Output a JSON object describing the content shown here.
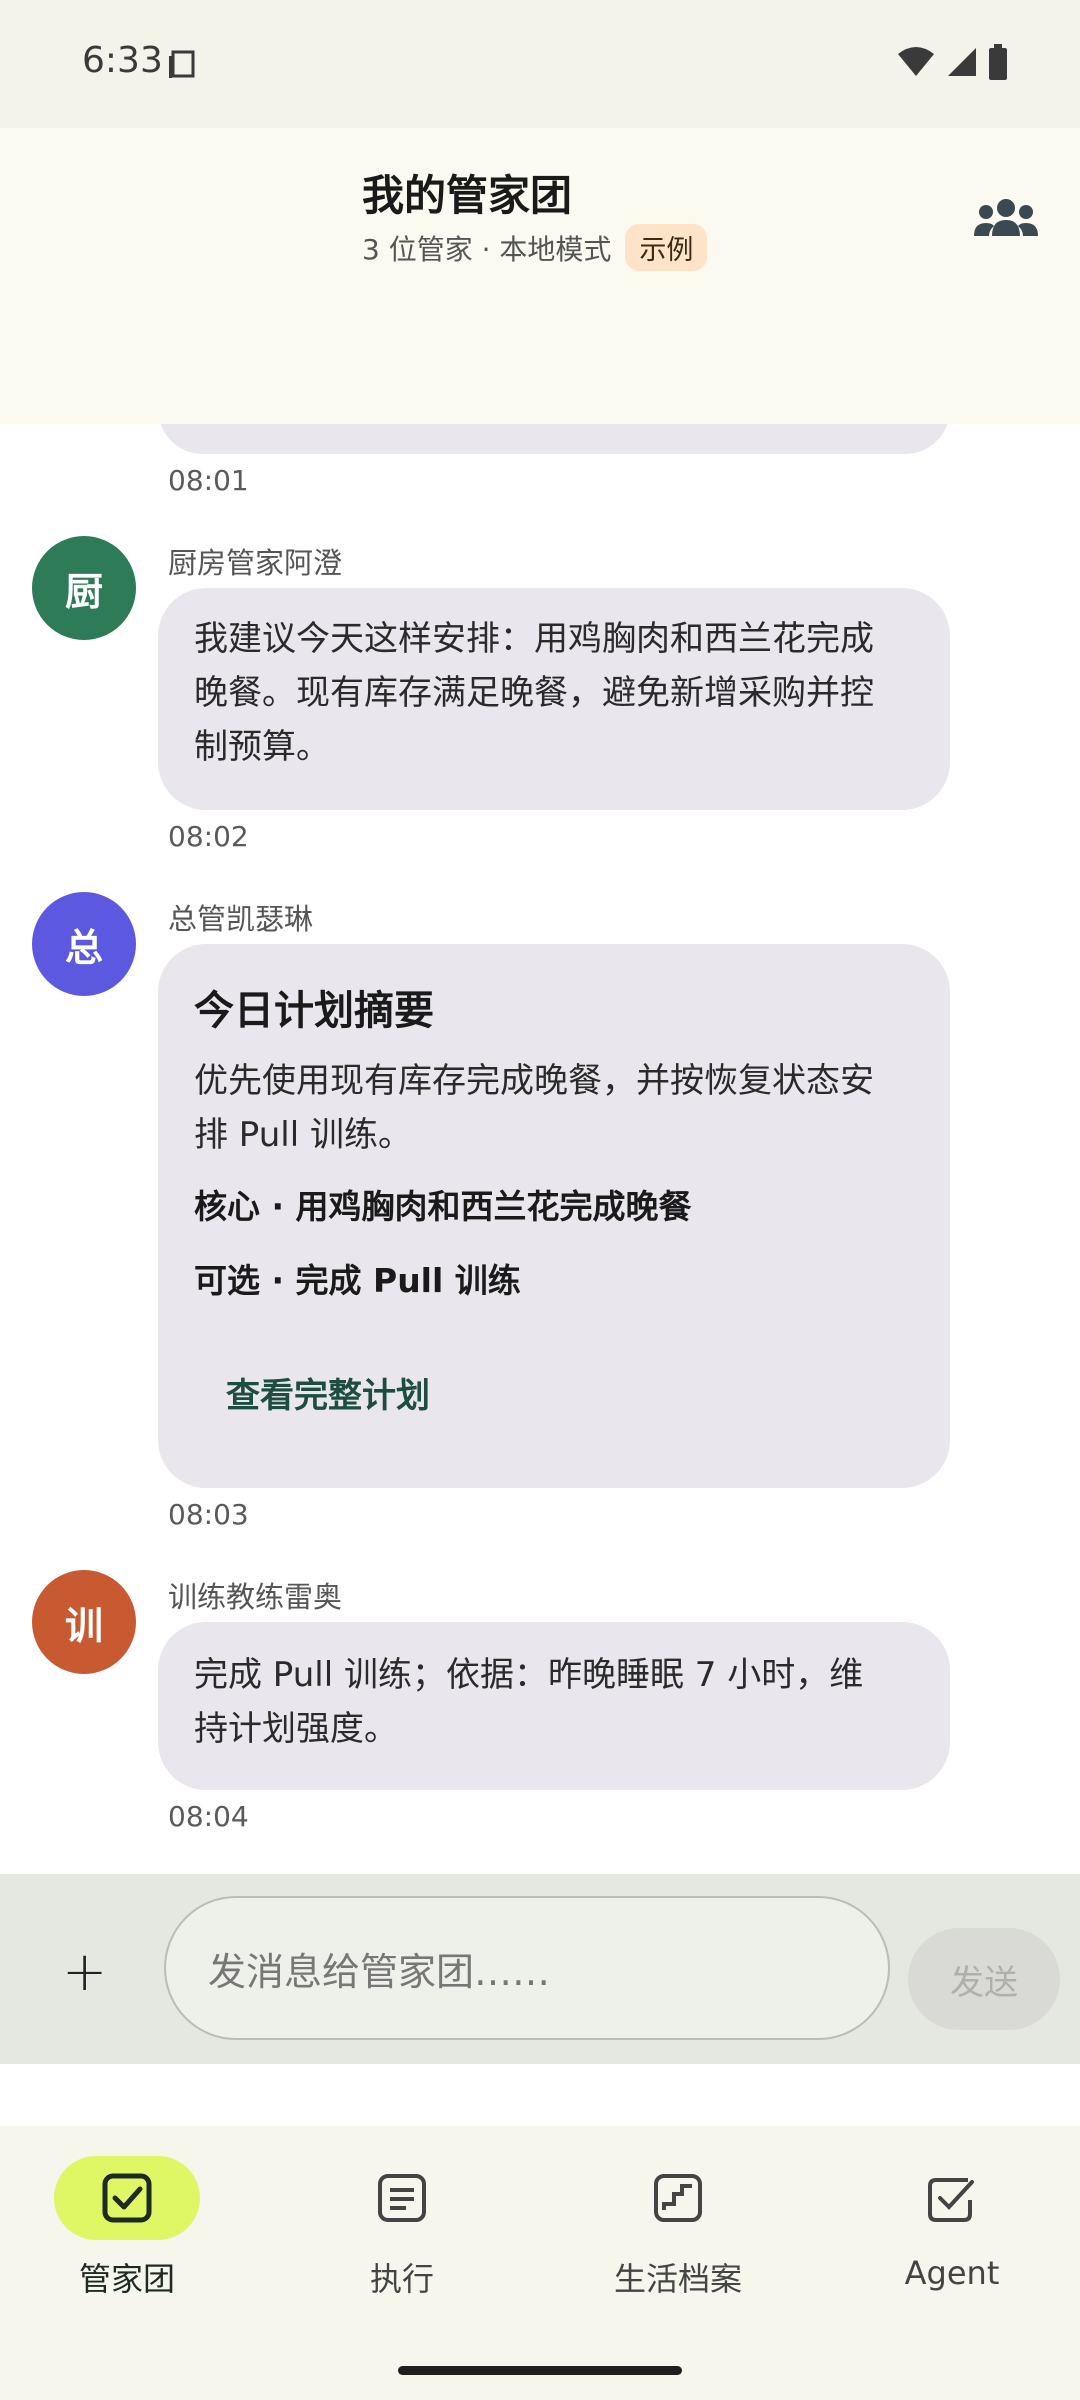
{
  "status": {
    "time": "6:33"
  },
  "header": {
    "title": "我的管家团",
    "subtitle": "3 位管家 · 本地模式",
    "badge": "示例"
  },
  "messages": [
    {
      "time": "08:01"
    },
    {
      "avatar_char": "厨",
      "avatar_color": "#2e7b58",
      "sender": "厨房管家阿澄",
      "lines": [
        "我建议今天这样安排：用鸡胸肉和西兰花完成",
        "晚餐。现有库存满足晚餐，避免新增采购并控",
        "制预算。"
      ],
      "time": "08:02"
    },
    {
      "avatar_char": "总",
      "avatar_color": "#5d58e0",
      "sender": "总管凯瑟琳",
      "card_title": "今日计划摘要",
      "lines": [
        "优先使用现有库存完成晚餐，并按恢复状态安",
        "排 Pull 训练。"
      ],
      "core": "核心 · 用鸡胸肉和西兰花完成晚餐",
      "optional": "可选 · 完成 Pull 训练",
      "link": "查看完整计划",
      "time": "08:03"
    },
    {
      "avatar_char": "训",
      "avatar_color": "#c85a32",
      "sender": "训练教练雷奥",
      "lines": [
        "完成 Pull 训练；依据：昨晚睡眠 7 小时，维",
        "持计划强度。"
      ],
      "time": "08:04"
    }
  ],
  "composer": {
    "placeholder": "发消息给管家团……",
    "send_label": "发送"
  },
  "nav": {
    "items": [
      {
        "label": "管家团",
        "active": true,
        "icon": "check-square-icon"
      },
      {
        "label": "执行",
        "active": false,
        "icon": "list-icon"
      },
      {
        "label": "生活档案",
        "active": false,
        "icon": "chart-icon"
      },
      {
        "label": "Agent",
        "active": false,
        "icon": "check-icon"
      }
    ]
  }
}
